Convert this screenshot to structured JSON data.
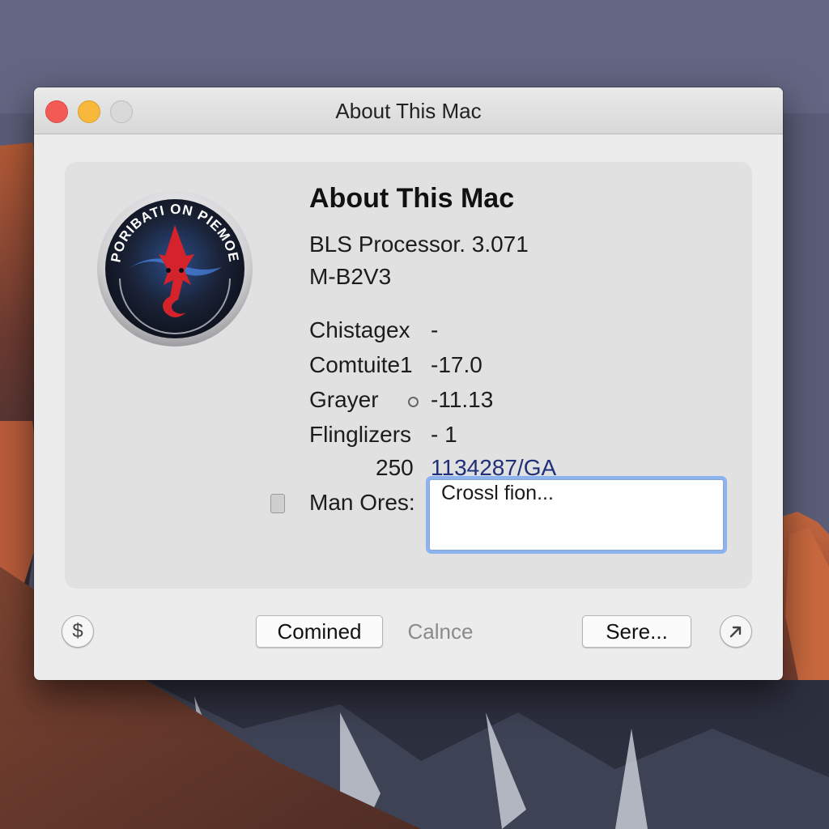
{
  "window": {
    "title": "About This Mac",
    "traffic_lights": {
      "close_color": "#f25b55",
      "minimize_color": "#f8b83b",
      "zoom_color": "#d9d9d9"
    }
  },
  "logo": {
    "ring_text": "PORIBATI ON PIEMOE"
  },
  "info": {
    "heading": "About This Mac",
    "processor": "BLS Processor. 3.071",
    "model": "M-B2V3",
    "specs": [
      {
        "label": "Chistagex",
        "value": "-"
      },
      {
        "label": "Comtuite1",
        "value": "-17.0"
      },
      {
        "label": "Grayer",
        "value": "-11.13"
      },
      {
        "label": "Flinglizers",
        "value": "- 1"
      },
      {
        "label": "250",
        "value": "1134287/GA"
      }
    ],
    "notes_label": "Man Ores:",
    "notes_value": "Crossl fion..."
  },
  "buttons": {
    "left_round_icon": "dollar-icon",
    "primary": "Comined",
    "secondary": "Calnce",
    "tertiary": "Sere...",
    "right_round_icon": "arrow-up-right-icon"
  },
  "colors": {
    "link": "#1f2f79",
    "focus_ring": "#8cb2f0"
  }
}
